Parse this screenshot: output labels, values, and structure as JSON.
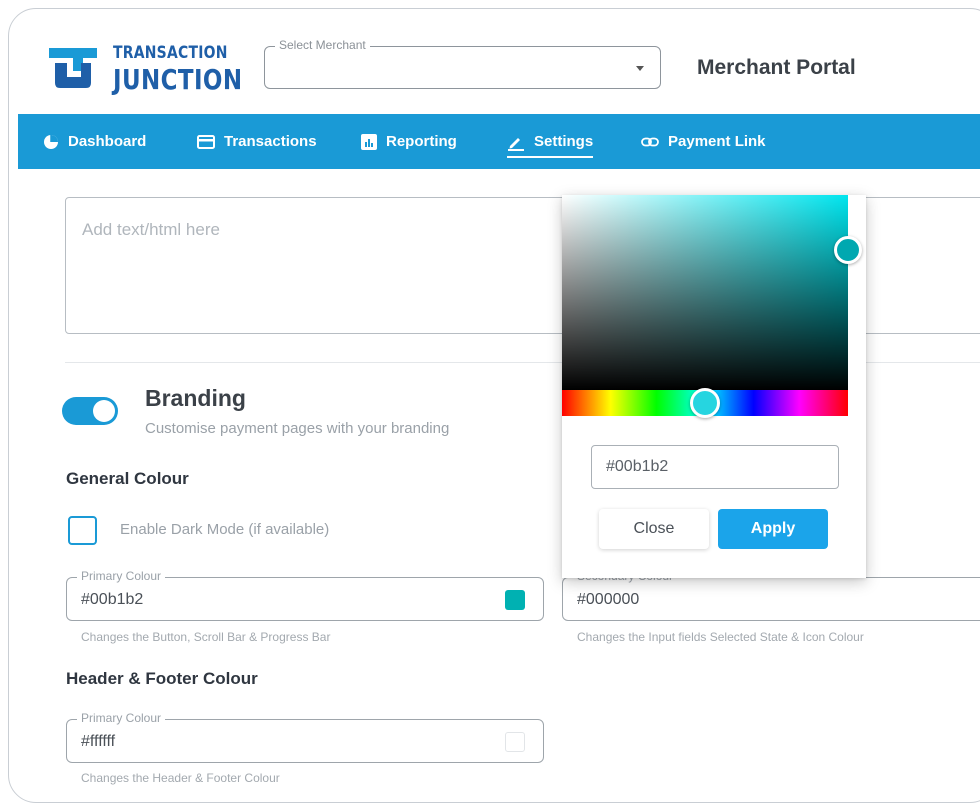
{
  "brand": {
    "line1": "TRANSACTION",
    "line2": "JUNCTION",
    "color": "#1f5fa8"
  },
  "header": {
    "merchant_select": {
      "label": "Select Merchant",
      "value": ""
    },
    "title": "Merchant Portal"
  },
  "nav": {
    "color": "#1a9ad6",
    "items": [
      {
        "label": "Dashboard",
        "icon": "pie-chart-icon",
        "active": false
      },
      {
        "label": "Transactions",
        "icon": "card-icon",
        "active": false
      },
      {
        "label": "Reporting",
        "icon": "report-icon",
        "active": false
      },
      {
        "label": "Settings",
        "icon": "pencil-icon",
        "active": true
      },
      {
        "label": "Payment Link",
        "icon": "link-icon",
        "active": false
      }
    ]
  },
  "content": {
    "html_box_placeholder": "Add text/html here",
    "branding": {
      "enabled": true,
      "title": "Branding",
      "subtitle": "Customise payment pages with your branding"
    },
    "general_colour": {
      "title": "General Colour",
      "dark_mode_label": "Enable Dark Mode (if available)",
      "dark_mode_checked": false,
      "primary": {
        "label": "Primary Colour",
        "value": "#00b1b2",
        "helper": "Changes the Button, Scroll Bar & Progress Bar"
      },
      "secondary": {
        "label": "Secondary Colour",
        "value": "#000000",
        "helper": "Changes the Input fields Selected State & Icon Colour"
      }
    },
    "header_footer_colour": {
      "title": "Header & Footer Colour",
      "primary": {
        "label": "Primary Colour",
        "value": "#ffffff",
        "helper": "Changes the Header & Footer Colour"
      }
    }
  },
  "color_picker": {
    "hex_value": "#00b1b2",
    "close_label": "Close",
    "apply_label": "Apply",
    "apply_color": "#1ba4ea"
  }
}
